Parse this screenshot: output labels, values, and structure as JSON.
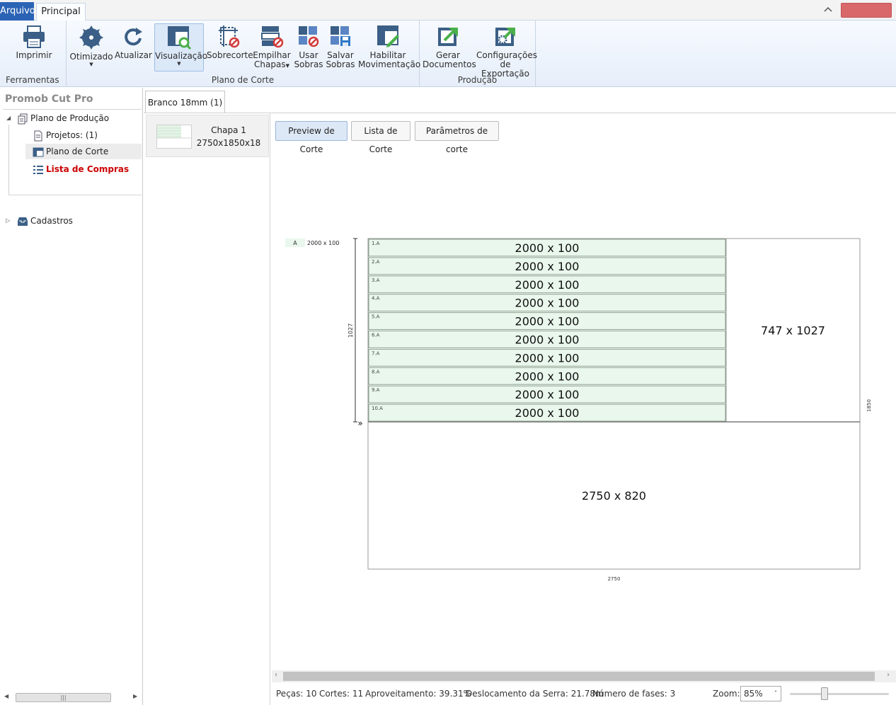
{
  "tabs": {
    "arquivo": "Arquivo",
    "principal": "Principal"
  },
  "ribbon": {
    "groups": {
      "ferramentas": "Ferramentas",
      "plano_corte": "Plano de Corte",
      "producao": "Produção"
    },
    "buttons": {
      "imprimir": "Imprimir",
      "otimizado": "Otimizado",
      "atualizar": "Atualizar",
      "visualizacao": "Visualização",
      "sobrecorte": "Sobrecorte",
      "empilhar_1": "Empilhar",
      "empilhar_2": "Chapas",
      "usar_1": "Usar",
      "usar_2": "Sobras",
      "salvar_1": "Salvar",
      "salvar_2": "Sobras",
      "habilitar_1": "Habilitar",
      "habilitar_2": "Movimentação",
      "gerar_1": "Gerar",
      "gerar_2": "Documentos",
      "config_1": "Configurações",
      "config_2": "de Exportação"
    }
  },
  "sidebar": {
    "title": "Promob Cut Pro",
    "plano_producao": "Plano de Produção",
    "projetos": "Projetos: (1)",
    "plano_corte": "Plano de Corte",
    "lista_compras": "Lista de Compras",
    "cadastros": "Cadastros"
  },
  "material_tab": "Branco 18mm (1)",
  "sheet": {
    "name": "Chapa 1",
    "dims": "2750x1850x18"
  },
  "view_tabs": {
    "preview": "Preview de Corte",
    "lista": "Lista de Corte",
    "parametros": "Parâmetros de corte"
  },
  "colors": {
    "piece_fill": "#e9f7ec",
    "piece_stroke": "#8aa08e",
    "accent": "#2b63b5",
    "highlight": "#cc0000"
  },
  "cut_plan": {
    "legend_badge": "A",
    "legend_text": "2000 x 100",
    "sheet_width": 2750,
    "sheet_height": 1850,
    "strip_height": 1027,
    "pieces": [
      {
        "id": "1.A",
        "label": "2000 x 100",
        "width": 2000,
        "height": 100
      },
      {
        "id": "2.A",
        "label": "2000 x 100",
        "width": 2000,
        "height": 100
      },
      {
        "id": "3.A",
        "label": "2000 x 100",
        "width": 2000,
        "height": 100
      },
      {
        "id": "4.A",
        "label": "2000 x 100",
        "width": 2000,
        "height": 100
      },
      {
        "id": "5.A",
        "label": "2000 x 100",
        "width": 2000,
        "height": 100
      },
      {
        "id": "6.A",
        "label": "2000 x 100",
        "width": 2000,
        "height": 100
      },
      {
        "id": "7.A",
        "label": "2000 x 100",
        "width": 2000,
        "height": 100
      },
      {
        "id": "8.A",
        "label": "2000 x 100",
        "width": 2000,
        "height": 100
      },
      {
        "id": "9.A",
        "label": "2000 x 100",
        "width": 2000,
        "height": 100
      },
      {
        "id": "10.A",
        "label": "2000 x 100",
        "width": 2000,
        "height": 100
      }
    ],
    "remnant_right": {
      "label": "747 x 1027",
      "width": 747,
      "height": 1027
    },
    "remnant_bottom": {
      "label": "2750 x 820",
      "width": 2750,
      "height": 820
    },
    "dim_left": "1027",
    "dim_right": "1850",
    "dim_bottom": "2750",
    "arrow_marker": "»"
  },
  "status": {
    "pecas": "Peças: 10",
    "cortes": "Cortes: 11",
    "aproveitamento": "Aproveitamento: 39.31%",
    "deslocamento": "Deslocamento da Serra: 21.78m",
    "fases": "Número de fases: 3",
    "zoom_label": "Zoom:",
    "zoom_value": "85%"
  }
}
